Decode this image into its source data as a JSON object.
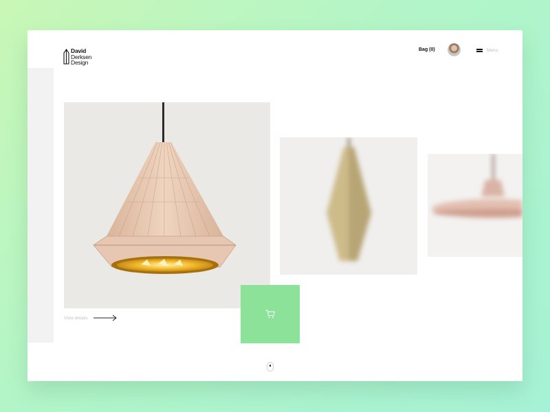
{
  "brand": {
    "logo_lines": [
      "David",
      "Derksen",
      "Design"
    ]
  },
  "header": {
    "bag_label": "Bag (0)",
    "menu_label": "Menu"
  },
  "product": {
    "view_details_label": "View details"
  },
  "colors": {
    "accent_green": "#8de29a",
    "background_gradient": [
      "#c9f7b6",
      "#a6f2d6"
    ]
  },
  "icons": {
    "cart": "cart-icon",
    "menu": "hamburger-icon",
    "arrow": "arrow-right-icon"
  }
}
